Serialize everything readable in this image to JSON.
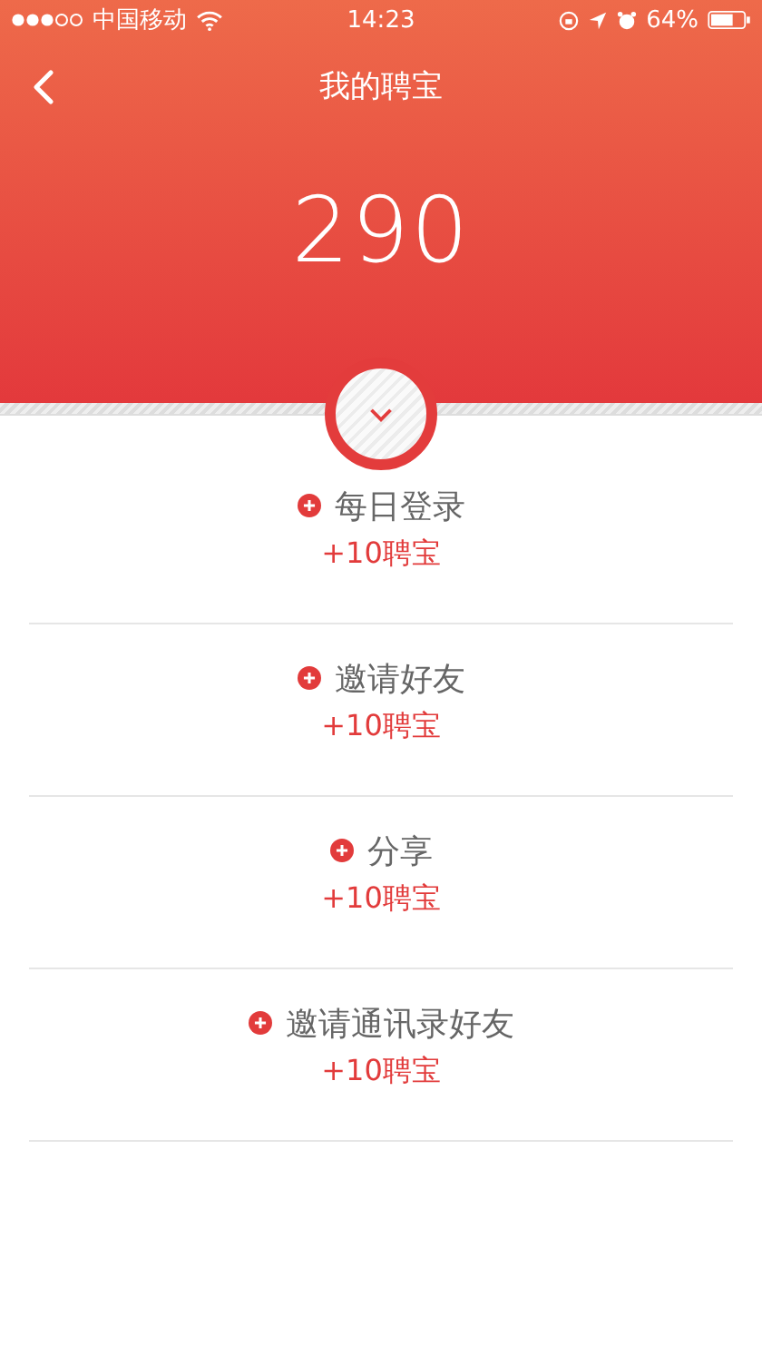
{
  "status_bar": {
    "carrier": "中国移动",
    "time": "14:23",
    "battery": "64%"
  },
  "nav": {
    "title": "我的聘宝"
  },
  "balance": "290",
  "tasks": [
    {
      "name": "每日登录",
      "reward": "+10聘宝"
    },
    {
      "name": "邀请好友",
      "reward": "+10聘宝"
    },
    {
      "name": "分享",
      "reward": "+10聘宝"
    },
    {
      "name": "邀请通讯录好友",
      "reward": "+10聘宝"
    }
  ]
}
